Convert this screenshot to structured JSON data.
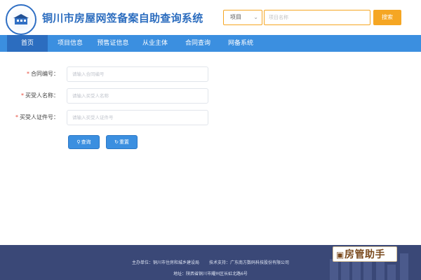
{
  "header": {
    "title": "铜川市房屋网签备案自助查询系统",
    "search": {
      "type_label": "项目",
      "placeholder": "项目名称",
      "button_label": "搜索"
    }
  },
  "nav": {
    "items": [
      {
        "label": "首页",
        "active": true
      },
      {
        "label": "项目信息",
        "active": false
      },
      {
        "label": "预售证信息",
        "active": false
      },
      {
        "label": "从业主体",
        "active": false
      },
      {
        "label": "合同查询",
        "active": false
      },
      {
        "label": "网备系统",
        "active": false
      }
    ]
  },
  "form": {
    "fields": [
      {
        "required_mark": "*",
        "label": "合同编号：",
        "placeholder": "请输入合同编号"
      },
      {
        "required_mark": "*",
        "label": "买受人名称：",
        "placeholder": "请输入买受人名称"
      },
      {
        "required_mark": "*",
        "label": "买受人证件号：",
        "placeholder": "请输入买受人证件号"
      }
    ],
    "query_label": "查询",
    "reset_label": "重置"
  },
  "footer": {
    "organizer": "主办单位：铜川市住房和城乡建设局",
    "tech_support": "技术支持：广东南方数码科技股份有限公司",
    "address": "地址：陕西省铜川市耀州区长虹北路6号"
  },
  "watermark": {
    "text": "房管助手"
  },
  "colors": {
    "primary": "#3b8fe0",
    "primary_dark": "#2c6dbf",
    "accent": "#f5a623",
    "footer": "#3a4877",
    "required": "#e74c3c"
  }
}
